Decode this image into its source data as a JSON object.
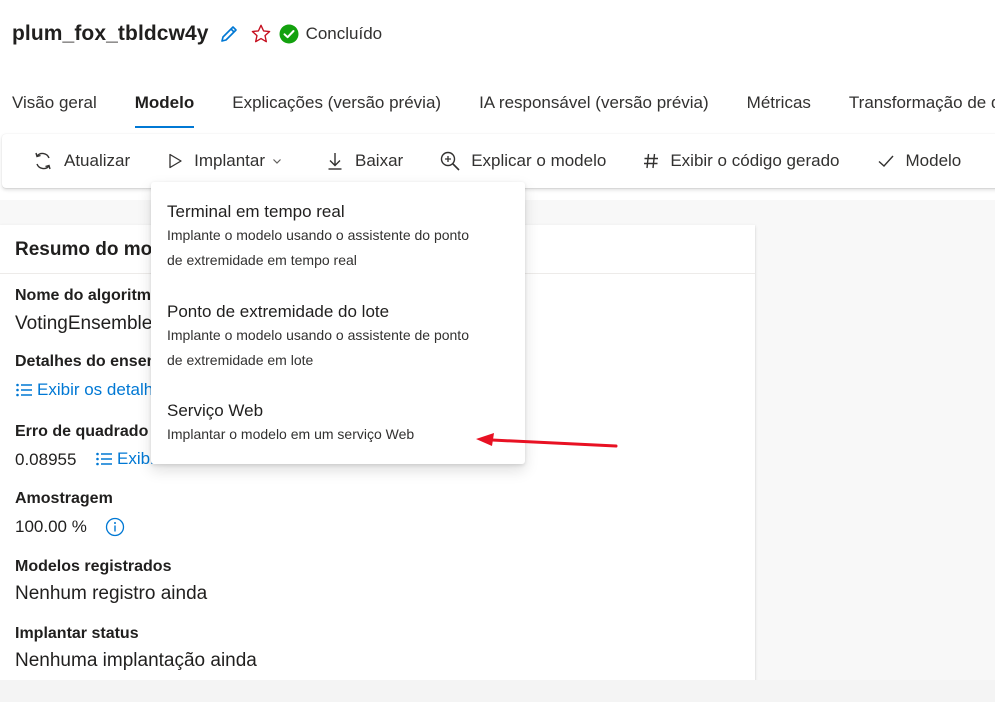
{
  "header": {
    "run_name": "plum_fox_tbldcw4y",
    "status_text": "Concluído",
    "colors": {
      "status_green": "#13a10e",
      "star_red": "#c50f1f",
      "edit_blue": "#0078d4",
      "accent": "#0078d4"
    }
  },
  "tabs": [
    {
      "label": "Visão geral"
    },
    {
      "label": "Modelo",
      "active": true
    },
    {
      "label": "Explicações (versão prévia)"
    },
    {
      "label": "IA responsável (versão prévia)"
    },
    {
      "label": "Métricas"
    },
    {
      "label": "Transformação de dados"
    }
  ],
  "toolbar": {
    "refresh_label": "Atualizar",
    "deploy_label": "Implantar",
    "download_label": "Baixar",
    "explain_label": "Explicar o modelo",
    "code_label": "Exibir o código gerado",
    "model_label": "Modelo"
  },
  "summary": {
    "title": "Resumo do modelo",
    "algorithm_label": "Nome do algoritmo",
    "algorithm_value": "VotingEnsemble",
    "ensemble_label": "Detalhes do ensemble",
    "ensemble_link": "Exibir os detalhes",
    "error_label": "Erro de quadrado médio",
    "error_value": "0.08955",
    "metrics_link": "Exibir todas as outras métricas",
    "sampling_label": "Amostragem",
    "sampling_value": "100.00 %",
    "registered_label": "Modelos registrados",
    "registered_value": "Nenhum registro ainda",
    "deploy_status_label": "Implantar status",
    "deploy_status_value": "Nenhuma implantação ainda"
  },
  "deploy_menu": {
    "items": [
      {
        "title": "Terminal em tempo real",
        "description_1": "Implante o modelo usando o assistente do ponto",
        "description_2": "de extremidade em tempo real"
      },
      {
        "title": "Ponto de extremidade do lote",
        "description_1": "Implante o modelo usando o assistente de ponto",
        "description_2": "de extremidade em lote"
      },
      {
        "title": "Serviço Web",
        "description_1": "Implantar o modelo em um serviço Web"
      }
    ]
  },
  "annotation": {
    "arrow_color": "#e81123"
  }
}
